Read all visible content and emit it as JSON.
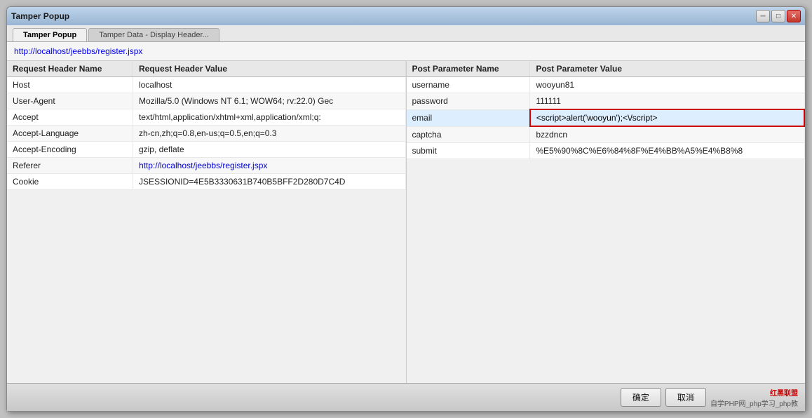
{
  "window": {
    "title": "Tamper Popup",
    "close_label": "✕",
    "min_label": "─",
    "max_label": "□"
  },
  "tabs": [
    {
      "label": "Tamper Popup",
      "active": true
    },
    {
      "label": "Tamper Data - Display Header...",
      "active": false
    }
  ],
  "url": "http://localhost/jeebbs/register.jspx",
  "left_panel": {
    "col1": "Request Header Name",
    "col2": "Request Header Value",
    "rows": [
      {
        "name": "Host",
        "value": "localhost",
        "link": false,
        "highlight": false
      },
      {
        "name": "User-Agent",
        "value": "Mozilla/5.0 (Windows NT 6.1; WOW64; rv:22.0) Gec",
        "link": false,
        "highlight": false
      },
      {
        "name": "Accept",
        "value": "text/html,application/xhtml+xml,application/xml;q:",
        "link": false,
        "highlight": false
      },
      {
        "name": "Accept-Language",
        "value": "zh-cn,zh;q=0.8,en-us;q=0.5,en;q=0.3",
        "link": false,
        "highlight": false
      },
      {
        "name": "Accept-Encoding",
        "value": "gzip, deflate",
        "link": false,
        "highlight": false
      },
      {
        "name": "Referer",
        "value": "http://localhost/jeebbs/register.jspx",
        "link": true,
        "highlight": false
      },
      {
        "name": "Cookie",
        "value": "JSESSIONID=4E5B3330631B740B5BFF2D280D7C4D",
        "link": false,
        "highlight": false
      }
    ]
  },
  "right_panel": {
    "col1": "Post Parameter Name",
    "col2": "Post Parameter Value",
    "rows": [
      {
        "name": "username",
        "value": "wooyun81",
        "link": false,
        "highlight": false,
        "red_border": false
      },
      {
        "name": "password",
        "value": "111111",
        "link": false,
        "highlight": false,
        "red_border": false
      },
      {
        "name": "email",
        "value": "<script>alert('wooyun');<\\/script>",
        "link": false,
        "highlight": true,
        "red_border": true
      },
      {
        "name": "captcha",
        "value": "bzzdncn",
        "link": false,
        "highlight": false,
        "red_border": false
      },
      {
        "name": "submit",
        "value": "%E5%90%8C%E6%84%8F%E4%BB%A5%E4%B8%8",
        "link": false,
        "highlight": false,
        "red_border": false
      }
    ]
  },
  "bottom": {
    "confirm_label": "确定",
    "cancel_label": "取消",
    "watermark1": "红黑联盟",
    "watermark2": "自学PHP网_php学习_php教"
  }
}
